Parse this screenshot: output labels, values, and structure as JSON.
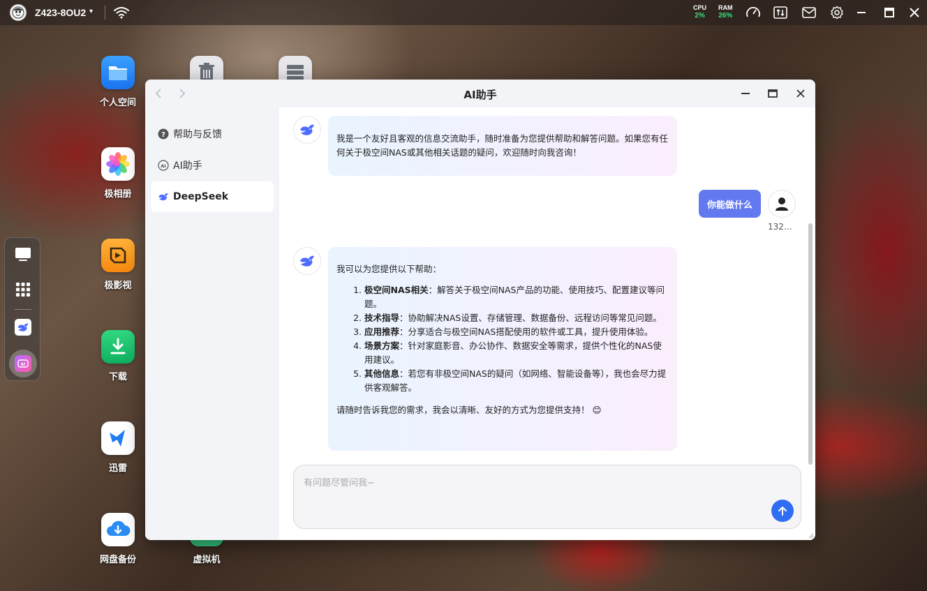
{
  "topbar": {
    "device_name": "Z423-8OU2",
    "cpu_label": "CPU",
    "cpu_value": "2%",
    "ram_label": "RAM",
    "ram_value": "26%",
    "metric_value_color": "#37e07a"
  },
  "desktop": {
    "icons": [
      {
        "label": "个人空间",
        "icon": "folder-icon"
      },
      {
        "label": "极相册",
        "icon": "photos-icon"
      },
      {
        "label": "极影视",
        "icon": "video-icon"
      },
      {
        "label": "下载",
        "icon": "download-icon"
      },
      {
        "label": "迅雷",
        "icon": "xunlei-icon"
      },
      {
        "label": "网盘备份",
        "icon": "cloud-backup-icon"
      },
      {
        "label": "虚拟机",
        "icon": "vm-icon"
      }
    ]
  },
  "dock": {
    "items": [
      "desktop-icon",
      "apps-grid-icon",
      "deepseek-icon",
      "ai-assistant-icon"
    ]
  },
  "window": {
    "title": "AI助手",
    "sidebar": {
      "items": [
        {
          "label": "帮助与反馈",
          "icon": "help-icon"
        },
        {
          "label": "AI助手",
          "icon": "ai-icon"
        },
        {
          "label": "DeepSeek",
          "icon": "deepseek-icon",
          "active": true
        }
      ]
    },
    "chat": {
      "messages": [
        {
          "role": "bot",
          "text": "我是一个友好且客观的信息交流助手，随时准备为您提供帮助和解答问题。如果您有任何关于极空间NAS或其他相关话题的疑问，欢迎随时向我咨询！"
        },
        {
          "role": "user",
          "text": "你能做什么",
          "user_name": "132…"
        },
        {
          "role": "bot",
          "intro": "我可以为您提供以下帮助：",
          "items": [
            {
              "title": "极空间NAS相关",
              "text": "：解答关于极空间NAS产品的功能、使用技巧、配置建议等问题。"
            },
            {
              "title": "技术指导",
              "text": "：协助解决NAS设置、存储管理、数据备份、远程访问等常见问题。"
            },
            {
              "title": "应用推荐",
              "text": "：分享适合与极空间NAS搭配使用的软件或工具，提升使用体验。"
            },
            {
              "title": "场景方案",
              "text": "：针对家庭影音、办公协作、数据安全等需求，提供个性化的NAS使用建议。"
            },
            {
              "title": "其他信息",
              "text": "：若您有非极空间NAS的疑问（如网络、智能设备等），我也会尽力提供客观解答。"
            }
          ],
          "outro": "请随时告诉我您的需求，我会以清晰、友好的方式为您提供支持！ 😊"
        }
      ]
    },
    "input": {
      "placeholder": "有问题尽管问我~",
      "value": ""
    },
    "colors": {
      "accent": "#2f6df2",
      "user_bubble": "#6279ef"
    }
  }
}
